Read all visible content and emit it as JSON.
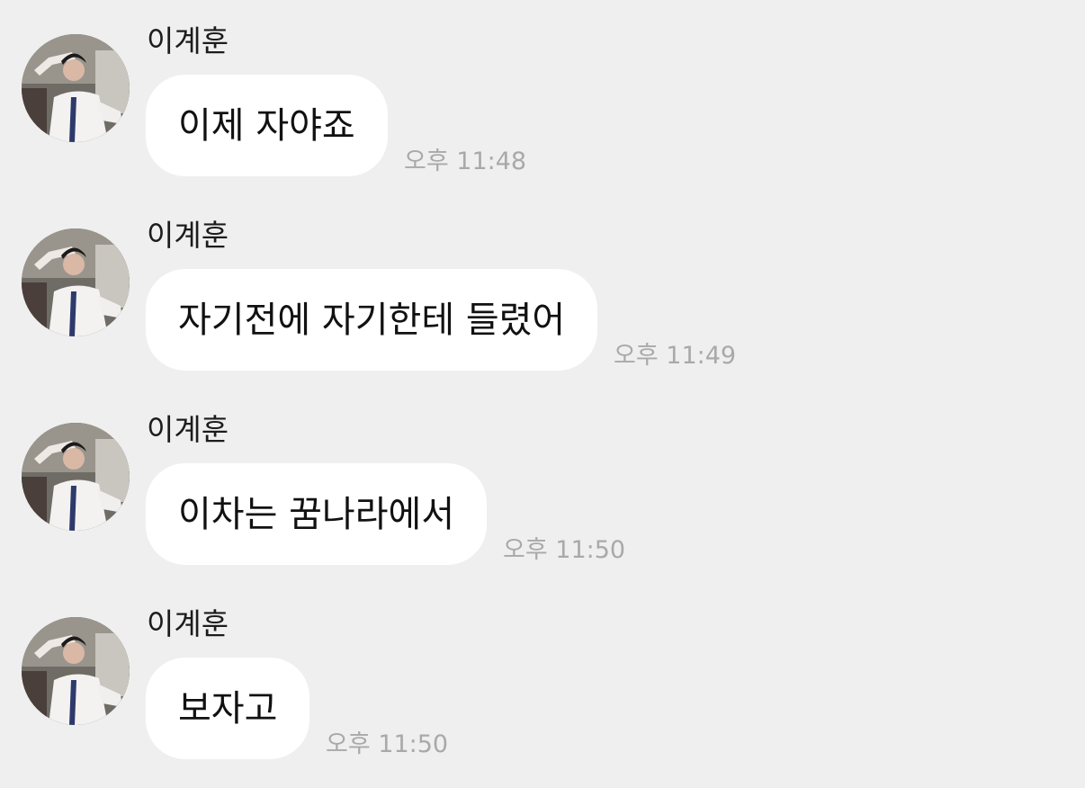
{
  "chat": {
    "messages": [
      {
        "sender": "이계훈",
        "text": "이제 자야죠",
        "time": "오후 11:48",
        "avatar_icon": "profile-photo"
      },
      {
        "sender": "이계훈",
        "text": "자기전에 자기한테 들렸어",
        "time": "오후 11:49",
        "avatar_icon": "profile-photo"
      },
      {
        "sender": "이계훈",
        "text": "이차는 꿈나라에서",
        "time": "오후 11:50",
        "avatar_icon": "profile-photo"
      },
      {
        "sender": "이계훈",
        "text": "보자고",
        "time": "오후 11:50",
        "avatar_icon": "profile-photo"
      }
    ]
  },
  "colors": {
    "background": "#efefef",
    "bubble": "#ffffff",
    "text": "#111111",
    "timestamp": "#a9a9a9"
  }
}
